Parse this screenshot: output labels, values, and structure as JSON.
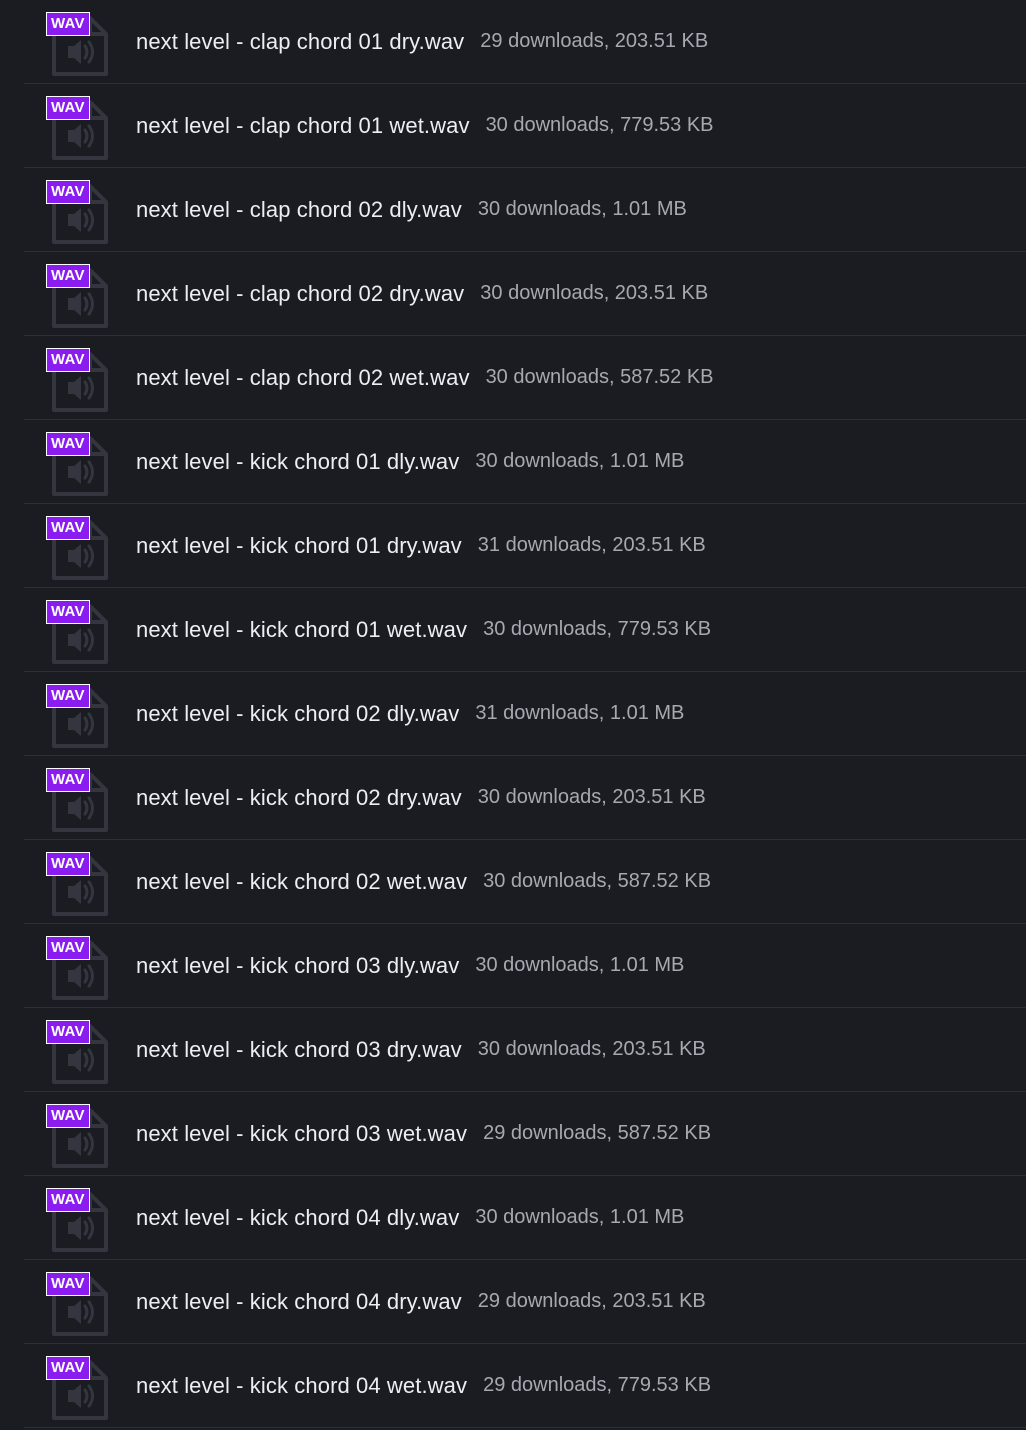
{
  "files": [
    {
      "badge": "WAV",
      "name": "next level - clap chord 01 dry.wav",
      "meta": "29 downloads, 203.51 KB"
    },
    {
      "badge": "WAV",
      "name": "next level - clap chord 01 wet.wav",
      "meta": "30 downloads, 779.53 KB"
    },
    {
      "badge": "WAV",
      "name": "next level - clap chord 02 dly.wav",
      "meta": "30 downloads, 1.01 MB"
    },
    {
      "badge": "WAV",
      "name": "next level - clap chord 02 dry.wav",
      "meta": "30 downloads, 203.51 KB"
    },
    {
      "badge": "WAV",
      "name": "next level - clap chord 02 wet.wav",
      "meta": "30 downloads, 587.52 KB"
    },
    {
      "badge": "WAV",
      "name": "next level - kick chord 01 dly.wav",
      "meta": "30 downloads, 1.01 MB"
    },
    {
      "badge": "WAV",
      "name": "next level - kick chord 01 dry.wav",
      "meta": "31 downloads, 203.51 KB"
    },
    {
      "badge": "WAV",
      "name": "next level - kick chord 01 wet.wav",
      "meta": "30 downloads, 779.53 KB"
    },
    {
      "badge": "WAV",
      "name": "next level - kick chord 02 dly.wav",
      "meta": "31 downloads, 1.01 MB"
    },
    {
      "badge": "WAV",
      "name": "next level - kick chord 02 dry.wav",
      "meta": "30 downloads, 203.51 KB"
    },
    {
      "badge": "WAV",
      "name": "next level - kick chord 02 wet.wav",
      "meta": "30 downloads, 587.52 KB"
    },
    {
      "badge": "WAV",
      "name": "next level - kick chord 03 dly.wav",
      "meta": "30 downloads, 1.01 MB"
    },
    {
      "badge": "WAV",
      "name": "next level - kick chord 03 dry.wav",
      "meta": "30 downloads, 203.51 KB"
    },
    {
      "badge": "WAV",
      "name": "next level - kick chord 03 wet.wav",
      "meta": "29 downloads, 587.52 KB"
    },
    {
      "badge": "WAV",
      "name": "next level - kick chord 04 dly.wav",
      "meta": "30 downloads, 1.01 MB"
    },
    {
      "badge": "WAV",
      "name": "next level - kick chord 04 dry.wav",
      "meta": "29 downloads, 203.51 KB"
    },
    {
      "badge": "WAV",
      "name": "next level - kick chord 04 wet.wav",
      "meta": "29 downloads, 779.53 KB"
    }
  ],
  "icons": {
    "file": "audio-file-icon"
  },
  "colors": {
    "background": "#1a1c22",
    "badge": "#8a1cf0",
    "row_divider": "#2d3038",
    "icon": "#33363f",
    "meta_text": "#a7a9b0"
  }
}
